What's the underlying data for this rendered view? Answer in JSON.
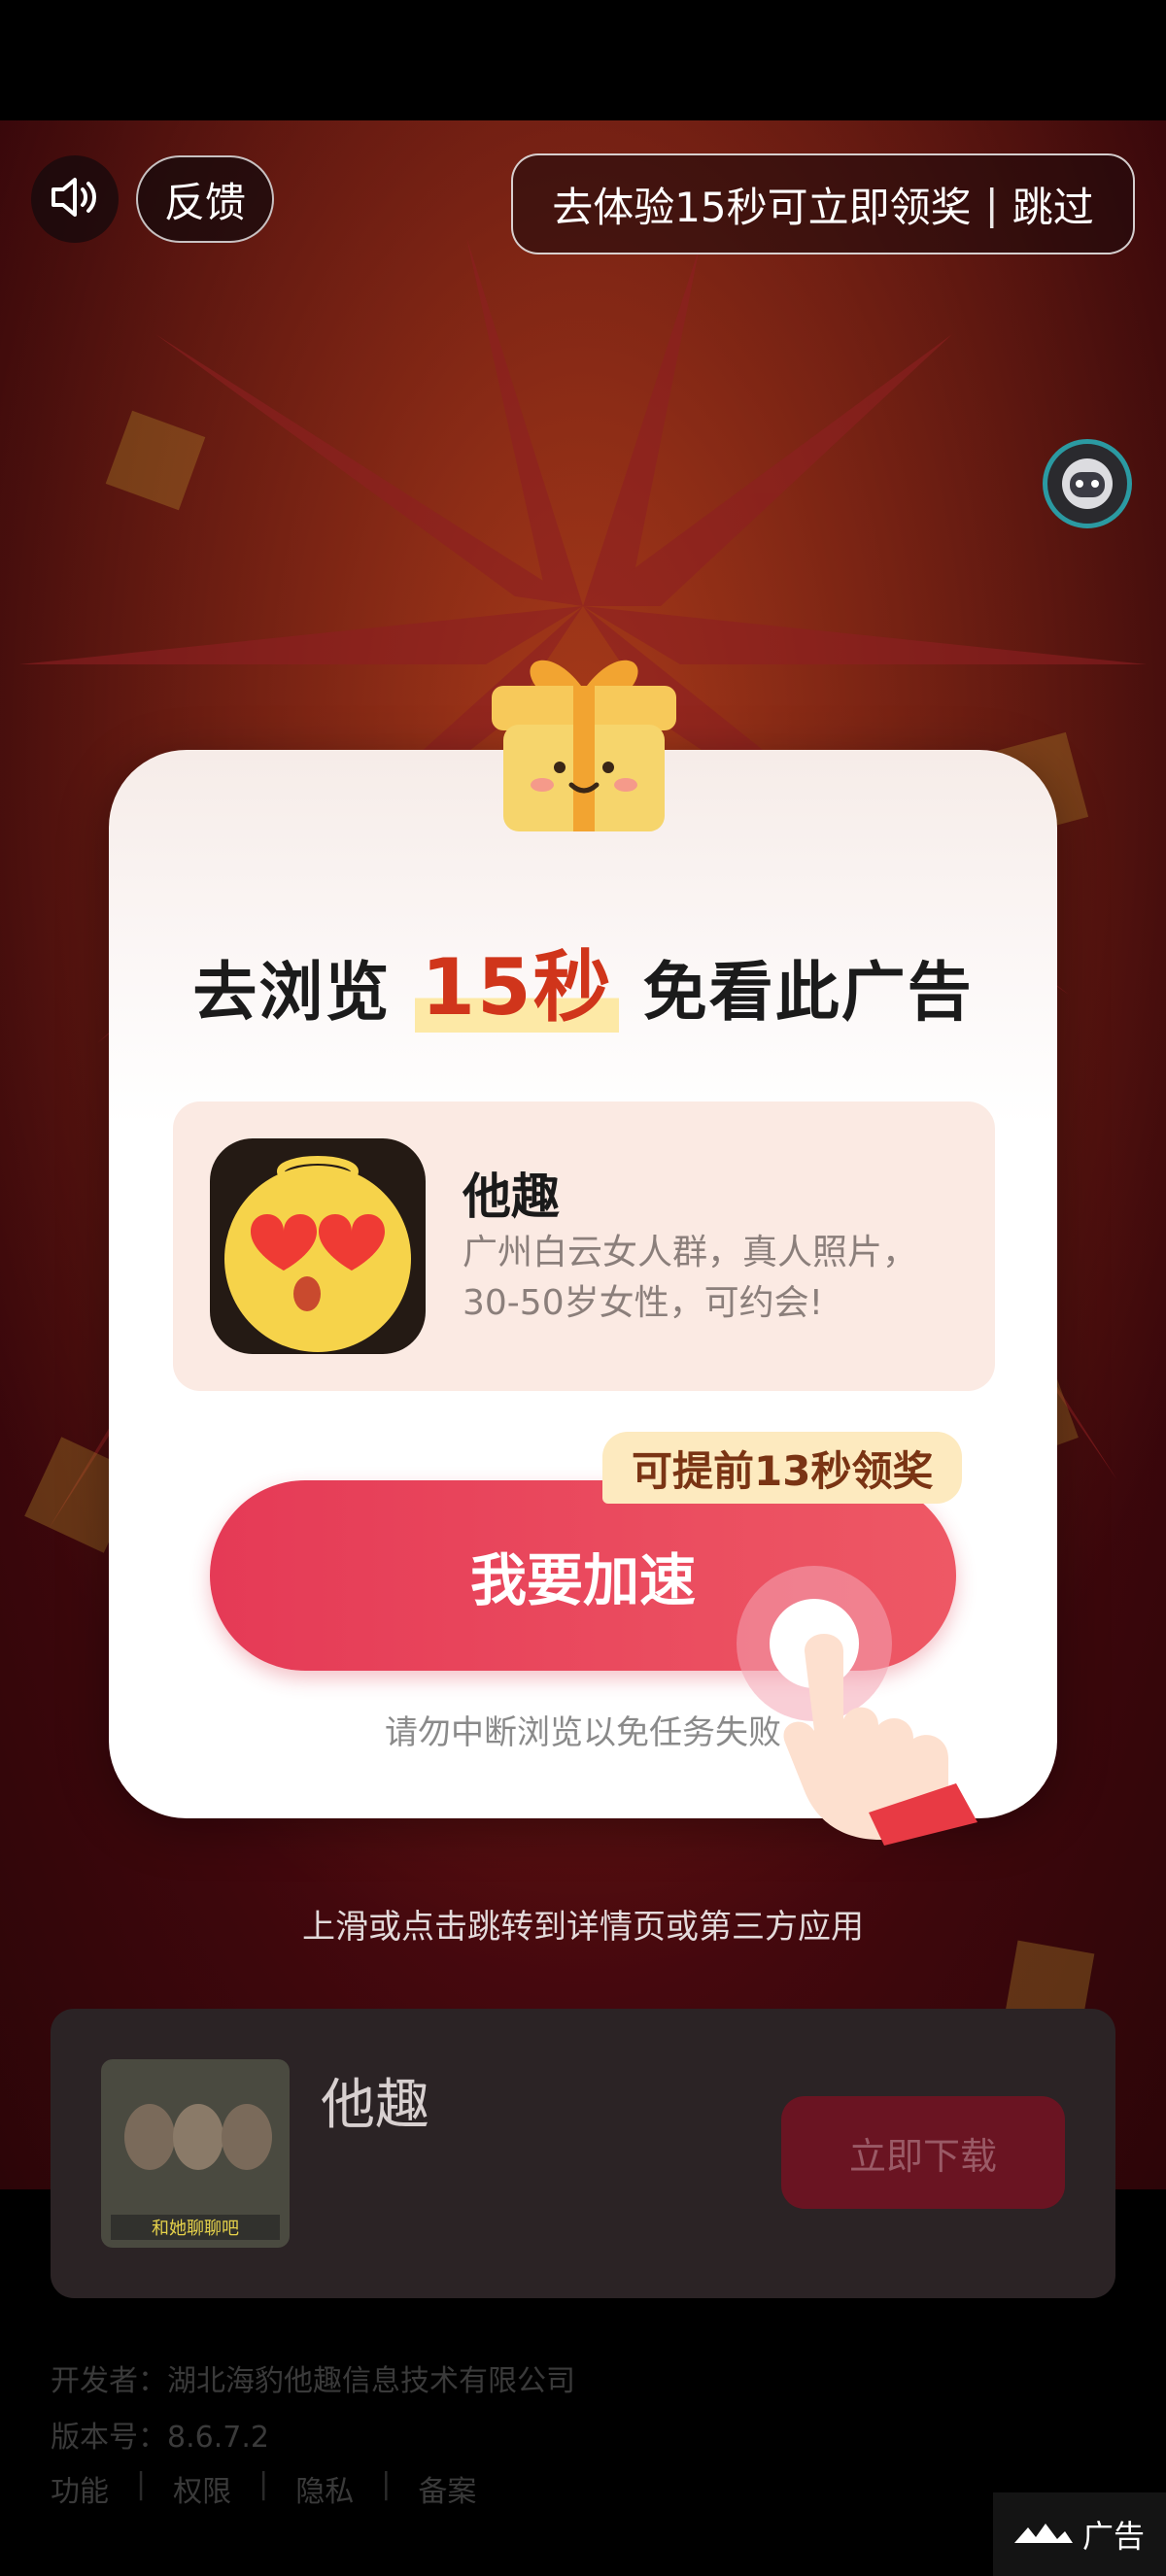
{
  "top_bar": {
    "feedback_label": "反馈",
    "skip_text": "去体验15秒可立即领奖",
    "skip_separator": "|",
    "skip_label": "跳过"
  },
  "modal": {
    "title_prefix": "去浏览",
    "title_highlight": "15秒",
    "title_suffix": "免看此广告",
    "app_name": "他趣",
    "app_desc": "广州白云女人群，真人照片，30-50岁女性，可约会!",
    "badge": "可提前13秒领奖",
    "speed_button": "我要加速",
    "warning": "请勿中断浏览以免任务失败"
  },
  "swipe_hint": "上滑或点击跳转到详情页或第三方应用",
  "bottom_card": {
    "app_name": "他趣",
    "thumb_caption": "和她聊聊吧",
    "download_label": "立即下载"
  },
  "footer": {
    "developer": "开发者：湖北海豹他趣信息技术有限公司",
    "version": "版本号：8.6.7.2",
    "links": [
      "功能",
      "权限",
      "隐私",
      "备案"
    ],
    "separator": "|"
  },
  "ad_tag": "广告",
  "colors": {
    "accent": "#e53a56",
    "highlight": "#d0351b",
    "badge_bg": "#fdeabf"
  }
}
